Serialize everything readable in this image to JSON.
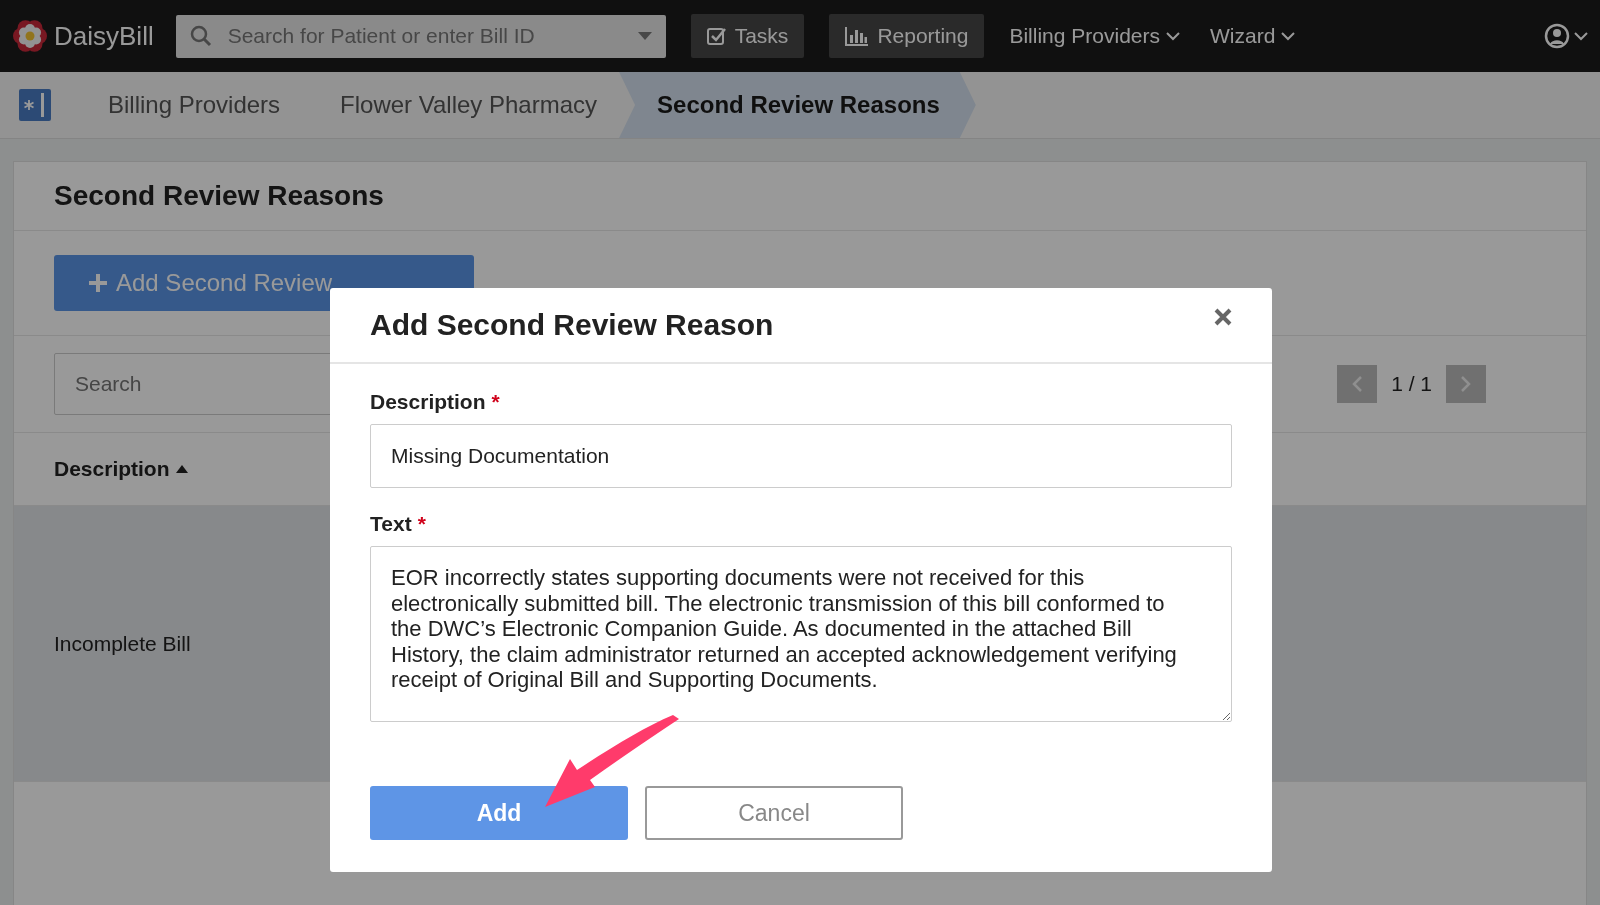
{
  "topbar": {
    "logo": "DaisyBill",
    "search": {
      "placeholder": "Search for Patient or enter Bill ID"
    },
    "nav": [
      {
        "kind": "button",
        "label": "Tasks"
      },
      {
        "kind": "button",
        "label": "Reporting"
      },
      {
        "kind": "dropdown",
        "label": "Billing Providers"
      },
      {
        "kind": "dropdown",
        "label": "Wizard"
      }
    ]
  },
  "breadcrumbs": [
    {
      "label": "Billing Providers",
      "selected": false
    },
    {
      "label": "Flower Valley Pharmacy",
      "selected": false
    },
    {
      "label": "Second Review Reasons",
      "selected": true
    }
  ],
  "page": {
    "title": "Second Review Reasons",
    "add_button": "Add Second Review",
    "search": {
      "placeholder": "Search"
    },
    "pagination": "1 / 1",
    "table": {
      "columns": [
        {
          "label": "Description",
          "sorted": true
        }
      ],
      "rows": [
        {
          "description": "Incomplete Bill",
          "selected": true
        },
        {
          "description": "",
          "selected": false
        }
      ]
    }
  },
  "modal": {
    "title": "Add Second Review Reason",
    "fields": [
      {
        "kind": "input",
        "label": "Description",
        "required_mark": "*",
        "value": "Missing Documentation"
      },
      {
        "kind": "textarea",
        "label": "Text",
        "required_mark": "*",
        "value": "EOR incorrectly states supporting documents were not received for this electronically submitted bill. The electronic transmission of this bill conformed to the DWC’s Electronic Companion Guide. As documented in the attached Bill History, the claim administrator returned an accepted acknowledgement verifying receipt of Original Bill and Supporting Documents."
      }
    ],
    "buttons": [
      {
        "kind": "primary",
        "label": "Add"
      },
      {
        "kind": "secondary",
        "label": "Cancel"
      }
    ]
  }
}
